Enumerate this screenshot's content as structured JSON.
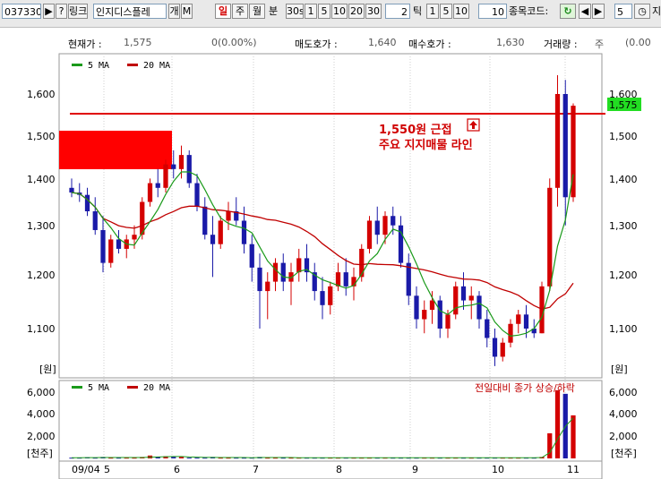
{
  "toolbar": {
    "code": "037330",
    "btn_play": "▶",
    "btn_help": "?",
    "btn_link": "링크",
    "name": "인지디스플레",
    "btn_g": "개",
    "btn_m": "M",
    "period_day": "일",
    "period_week": "주",
    "period_month": "월",
    "period_min": "분",
    "min_opts": [
      "30s",
      "1",
      "5",
      "10",
      "20",
      "30"
    ],
    "n_value": "2",
    "tick_label": "틱",
    "tick_opts": [
      "1",
      "5",
      "10"
    ],
    "tick_value": "10",
    "search_label": "종목코드:",
    "count_value": "5",
    "tail_char": "지"
  },
  "price_bar": {
    "cur_label": "현재가 :",
    "cur_val": "1,575",
    "change_val": "0(0.00%)",
    "ask_label": "매도호가 :",
    "ask_val": "1,640",
    "bid_label": "매수호가 :",
    "bid_val": "1,630",
    "vol_label": "거래량 :",
    "vol_val": "주",
    "right_val": "(0.00"
  },
  "legend": {
    "ma5": "5 MA",
    "ma20": "20 MA",
    "vol_note": "전일대비 종가 상승/하락"
  },
  "y_axis": {
    "ticks": [
      "1,600",
      "1,500",
      "1,400",
      "1,300",
      "1,200",
      "1,100"
    ],
    "unit": "[원]",
    "current_price": "1,575"
  },
  "vol_axis": {
    "ticks": [
      "6,000",
      "4,000",
      "2,000"
    ],
    "unit": "[천주]"
  },
  "x_axis": {
    "labels": [
      "09/04",
      "5",
      "6",
      "7",
      "8",
      "9",
      "10",
      "11"
    ]
  },
  "annotation": {
    "line1": "1,550원 근접",
    "line2": "주요 지지매물 라인"
  },
  "colors": {
    "up": "#d40000",
    "down": "#1a1aa8",
    "ma5": "#1a9a1a",
    "ma20": "#c00000",
    "support_line": "#e00000",
    "box": "#ff0000",
    "current_tag": "#22dd22"
  },
  "chart_data": {
    "type": "candlestick",
    "price_range": [
      1040,
      1650
    ],
    "support_level": 1550,
    "resistance_box": [
      1420,
      1510
    ],
    "candles": [
      [
        1400,
        1420,
        1380,
        1390
      ],
      [
        1390,
        1410,
        1370,
        1385
      ],
      [
        1385,
        1400,
        1340,
        1350
      ],
      [
        1350,
        1380,
        1300,
        1310
      ],
      [
        1310,
        1340,
        1220,
        1240
      ],
      [
        1240,
        1300,
        1230,
        1290
      ],
      [
        1290,
        1310,
        1260,
        1270
      ],
      [
        1270,
        1300,
        1250,
        1290
      ],
      [
        1290,
        1320,
        1270,
        1300
      ],
      [
        1300,
        1380,
        1290,
        1370
      ],
      [
        1370,
        1420,
        1360,
        1410
      ],
      [
        1410,
        1440,
        1380,
        1400
      ],
      [
        1400,
        1460,
        1390,
        1450
      ],
      [
        1450,
        1480,
        1420,
        1440
      ],
      [
        1440,
        1490,
        1420,
        1470
      ],
      [
        1470,
        1480,
        1400,
        1410
      ],
      [
        1410,
        1430,
        1350,
        1360
      ],
      [
        1360,
        1380,
        1290,
        1300
      ],
      [
        1300,
        1340,
        1210,
        1280
      ],
      [
        1280,
        1340,
        1270,
        1330
      ],
      [
        1330,
        1370,
        1310,
        1350
      ],
      [
        1350,
        1380,
        1320,
        1330
      ],
      [
        1330,
        1360,
        1260,
        1280
      ],
      [
        1280,
        1300,
        1200,
        1230
      ],
      [
        1230,
        1260,
        1100,
        1180
      ],
      [
        1180,
        1220,
        1120,
        1200
      ],
      [
        1200,
        1250,
        1180,
        1240
      ],
      [
        1240,
        1260,
        1180,
        1200
      ],
      [
        1200,
        1240,
        1150,
        1220
      ],
      [
        1220,
        1270,
        1200,
        1250
      ],
      [
        1250,
        1280,
        1200,
        1220
      ],
      [
        1220,
        1240,
        1160,
        1180
      ],
      [
        1180,
        1210,
        1120,
        1150
      ],
      [
        1150,
        1200,
        1130,
        1190
      ],
      [
        1190,
        1240,
        1180,
        1220
      ],
      [
        1220,
        1250,
        1170,
        1190
      ],
      [
        1190,
        1230,
        1160,
        1210
      ],
      [
        1210,
        1280,
        1200,
        1270
      ],
      [
        1270,
        1340,
        1260,
        1330
      ],
      [
        1330,
        1360,
        1280,
        1300
      ],
      [
        1300,
        1350,
        1280,
        1340
      ],
      [
        1340,
        1360,
        1300,
        1320
      ],
      [
        1320,
        1340,
        1230,
        1240
      ],
      [
        1240,
        1260,
        1150,
        1170
      ],
      [
        1170,
        1190,
        1100,
        1120
      ],
      [
        1120,
        1160,
        1090,
        1140
      ],
      [
        1140,
        1180,
        1110,
        1160
      ],
      [
        1160,
        1170,
        1080,
        1100
      ],
      [
        1100,
        1140,
        1080,
        1130
      ],
      [
        1130,
        1200,
        1120,
        1190
      ],
      [
        1190,
        1220,
        1140,
        1160
      ],
      [
        1160,
        1190,
        1120,
        1170
      ],
      [
        1170,
        1180,
        1100,
        1120
      ],
      [
        1120,
        1140,
        1060,
        1080
      ],
      [
        1080,
        1100,
        1020,
        1040
      ],
      [
        1040,
        1080,
        1030,
        1070
      ],
      [
        1070,
        1120,
        1060,
        1110
      ],
      [
        1110,
        1140,
        1090,
        1130
      ],
      [
        1130,
        1150,
        1080,
        1100
      ],
      [
        1100,
        1120,
        1080,
        1090
      ],
      [
        1090,
        1200,
        1090,
        1190
      ],
      [
        1190,
        1420,
        1180,
        1400
      ],
      [
        1400,
        1640,
        1360,
        1600
      ],
      [
        1600,
        1630,
        1320,
        1380
      ],
      [
        1380,
        1580,
        1370,
        1575
      ]
    ],
    "volume_rel": [
      0.01,
      0.01,
      0.015,
      0.01,
      0.02,
      0.01,
      0.01,
      0.01,
      0.01,
      0.02,
      0.04,
      0.02,
      0.03,
      0.02,
      0.02,
      0.01,
      0.01,
      0.01,
      0.02,
      0.01,
      0.01,
      0.01,
      0.01,
      0.01,
      0.02,
      0.01,
      0.01,
      0.01,
      0.01,
      0.01,
      0.01,
      0.01,
      0.01,
      0.01,
      0.01,
      0.01,
      0.01,
      0.01,
      0.01,
      0.01,
      0.01,
      0.01,
      0.01,
      0.01,
      0.01,
      0.01,
      0.01,
      0.01,
      0.01,
      0.01,
      0.01,
      0.01,
      0.01,
      0.01,
      0.01,
      0.01,
      0.01,
      0.01,
      0.01,
      0.01,
      0.02,
      0.35,
      0.95,
      0.9,
      0.6
    ],
    "volume_axis_max": 6500
  }
}
